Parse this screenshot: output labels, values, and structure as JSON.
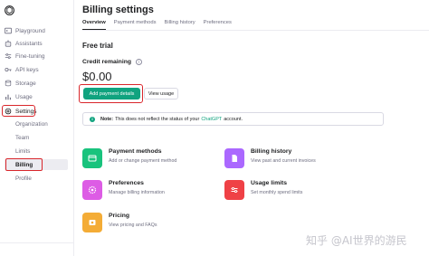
{
  "sidebar": {
    "items": [
      {
        "label": "Playground",
        "icon": "terminal-icon"
      },
      {
        "label": "Assistants",
        "icon": "robot-icon"
      },
      {
        "label": "Fine-tuning",
        "icon": "tune-icon"
      },
      {
        "label": "API keys",
        "icon": "key-icon"
      },
      {
        "label": "Storage",
        "icon": "storage-icon"
      },
      {
        "label": "Usage",
        "icon": "bar-chart-icon"
      },
      {
        "label": "Settings",
        "icon": "gear-icon"
      }
    ],
    "sub_items": [
      "Organization",
      "Team",
      "Limits",
      "Billing",
      "Profile"
    ],
    "active_item": "Billing"
  },
  "header": {
    "title": "Billing settings",
    "tabs": [
      "Overview",
      "Payment methods",
      "Billing history",
      "Preferences"
    ],
    "active_tab": "Overview"
  },
  "main": {
    "plan": "Free trial",
    "credit_label": "Credit remaining",
    "balance": "$0.00",
    "add_payment_label": "Add payment details",
    "view_usage_label": "View usage",
    "note": {
      "bold": "Note:",
      "text_before": "This does not reflect the status of your",
      "link": "ChatGPT",
      "text_after": "account."
    },
    "cards": [
      {
        "title": "Payment methods",
        "desc": "Add or change payment method",
        "icon": "credit-card-icon",
        "color": "#19c37d"
      },
      {
        "title": "Billing history",
        "desc": "View past and current invoices",
        "icon": "document-icon",
        "color": "#ab68ff"
      },
      {
        "title": "Preferences",
        "desc": "Manage billing information",
        "icon": "gear-icon",
        "color": "#dd5ce5"
      },
      {
        "title": "Usage limits",
        "desc": "Set monthly spend limits",
        "icon": "sliders-icon",
        "color": "#ef4146"
      },
      {
        "title": "Pricing",
        "desc": "View pricing and FAQs",
        "icon": "pricing-icon",
        "color": "#f4ac36"
      }
    ]
  },
  "watermark": "知乎 @AI世界的游民",
  "colors": {
    "accent": "#10a37f",
    "highlight": "#d9262b"
  }
}
